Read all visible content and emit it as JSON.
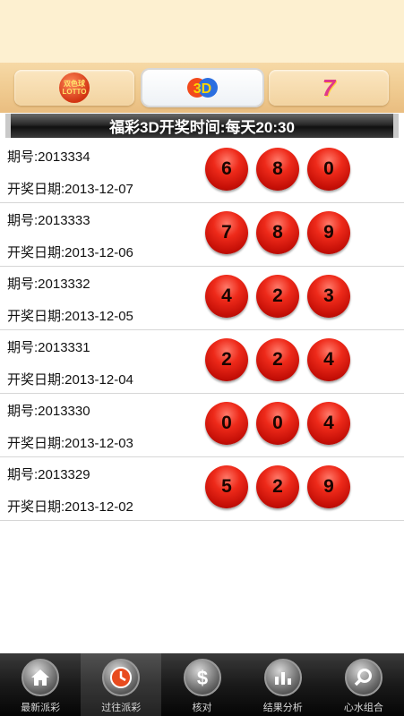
{
  "banner": "福彩3D开奖时间:每天20:30",
  "lottery_tabs": [
    {
      "name": "ssq",
      "logo_text": "双色球 UNION LOTTO"
    },
    {
      "name": "3d",
      "logo_text": "3D"
    },
    {
      "name": "qlc",
      "logo_text": "7"
    }
  ],
  "draws": [
    {
      "issue": "期号:2013334",
      "date": "开奖日期:2013-12-07",
      "numbers": [
        "6",
        "8",
        "0"
      ]
    },
    {
      "issue": "期号:2013333",
      "date": "开奖日期:2013-12-06",
      "numbers": [
        "7",
        "8",
        "9"
      ]
    },
    {
      "issue": "期号:2013332",
      "date": "开奖日期:2013-12-05",
      "numbers": [
        "4",
        "2",
        "3"
      ]
    },
    {
      "issue": "期号:2013331",
      "date": "开奖日期:2013-12-04",
      "numbers": [
        "2",
        "2",
        "4"
      ]
    },
    {
      "issue": "期号:2013330",
      "date": "开奖日期:2013-12-03",
      "numbers": [
        "0",
        "0",
        "4"
      ]
    },
    {
      "issue": "期号:2013329",
      "date": "开奖日期:2013-12-02",
      "numbers": [
        "5",
        "2",
        "9"
      ]
    }
  ],
  "tabbar": [
    {
      "label": "最新派彩",
      "icon": "home-icon"
    },
    {
      "label": "过往派彩",
      "icon": "history-icon"
    },
    {
      "label": "核对",
      "icon": "dollar-icon"
    },
    {
      "label": "结果分析",
      "icon": "bar-chart-icon"
    },
    {
      "label": "心水组合",
      "icon": "search-icon"
    }
  ],
  "colors": {
    "ball": "#e8200f",
    "tabbar": "#1a1a1a",
    "header_bg": "#fdf0d0"
  }
}
